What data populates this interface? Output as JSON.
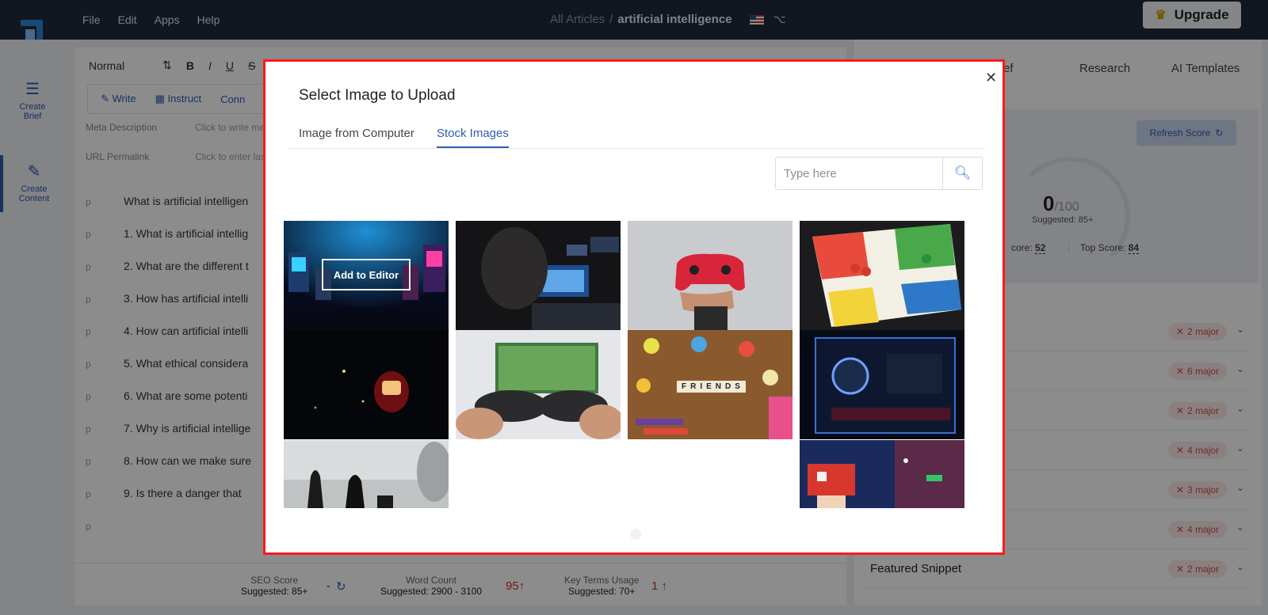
{
  "topbar": {
    "menu": [
      "File",
      "Edit",
      "Apps",
      "Help"
    ],
    "breadcrumb_root": "All Articles",
    "breadcrumb_sep": "/",
    "breadcrumb_current": "artificial intelligence",
    "upgrade_label": "Upgrade"
  },
  "rail": {
    "items": [
      {
        "label": "Create Brief",
        "icon": "list-icon"
      },
      {
        "label": "Create Content",
        "icon": "edit-icon"
      }
    ]
  },
  "editor": {
    "style_select": "Normal",
    "format_buttons": [
      "B",
      "I",
      "U",
      "S"
    ],
    "sub_actions": [
      "Write",
      "Instruct",
      "Conn"
    ],
    "meta_description_label": "Meta Description",
    "meta_description_value": "Click to write me",
    "url_label": "URL Permalink",
    "url_value": "Click to enter las",
    "paragraph_tag": "p",
    "lines": [
      "What is artificial intelligen",
      "1. What is artificial intellig",
      "2. What are the different t",
      "3. How has artificial intelli",
      "4. How can artificial intelli",
      "5. What ethical considera",
      "6. What are some potenti",
      "7. Why is artificial intellige",
      "8. How can we make sure",
      "9. Is there a danger that",
      ""
    ],
    "metrics": {
      "seo_label": "SEO Score",
      "seo_sugg": "Suggested: 85+",
      "seo_value": "-",
      "wc_label": "Word Count",
      "wc_sugg": "Suggested: 2900 - 3100",
      "wc_value": "95",
      "kt_label": "Key Terms Usage",
      "kt_sugg": "Suggested: 70+",
      "kt_value": "1"
    }
  },
  "right_panel": {
    "tabs": [
      "ef",
      "Research",
      "AI Templates"
    ],
    "refresh_label": "Refresh Score",
    "score": "0",
    "score_max": "/100",
    "score_sugg": "Suggested: 85+",
    "avg_label": "core:",
    "avg_value": "52",
    "top_label": "Top Score:",
    "top_value": "84",
    "issues": [
      {
        "label": "",
        "badge": "2 major"
      },
      {
        "label": "",
        "badge": "6 major"
      },
      {
        "label": "",
        "badge": "2 major"
      },
      {
        "label": "",
        "badge": "4 major"
      },
      {
        "label": "",
        "badge": "3 major"
      },
      {
        "label": "",
        "badge": "4 major"
      },
      {
        "label": "Featured Snippet",
        "badge": "2 major"
      }
    ]
  },
  "modal": {
    "title": "Select Image to Upload",
    "tabs": [
      "Image from Computer",
      "Stock Images"
    ],
    "active_tab": "Stock Images",
    "search_placeholder": "Type here",
    "add_to_editor": "Add to Editor",
    "friends_tiles": "FRIENDS",
    "images": [
      {
        "subject": "arcade-neon-room"
      },
      {
        "subject": "hooded-gamer-monitors"
      },
      {
        "subject": "hand-holding-red-controller"
      },
      {
        "subject": "ludo-board-game"
      },
      {
        "subject": "hooded-figure-led-mask"
      },
      {
        "subject": "hands-gamepads-football-tv"
      },
      {
        "subject": "toys-friends-tiles"
      },
      {
        "subject": "pc-liquid-cooling"
      },
      {
        "subject": "chess-pieces"
      },
      {
        "subject": "pixel-mushroom-wall"
      }
    ]
  },
  "colors": {
    "accent": "#2b5db3",
    "modal_border": "#ff1a1a",
    "topbar": "#1f2a3c",
    "badge_text": "#d14b4b"
  }
}
